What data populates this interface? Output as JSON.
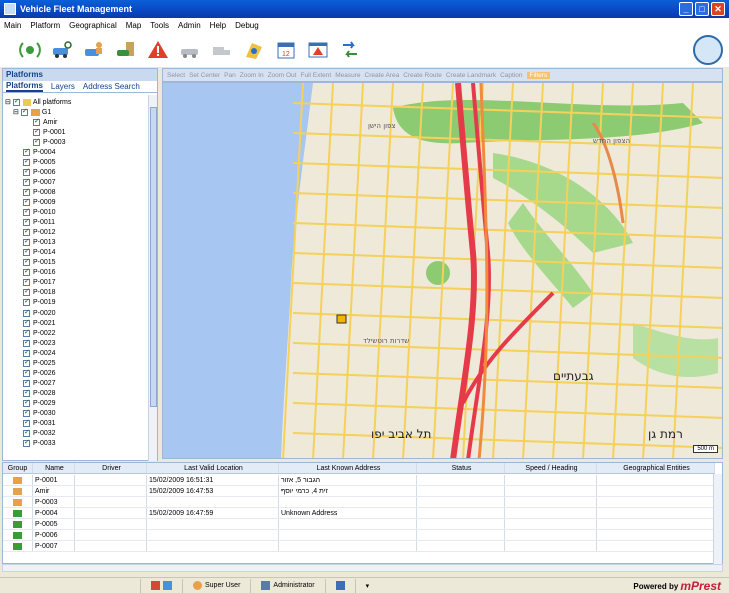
{
  "window": {
    "title": "Vehicle Fleet Management",
    "buttons": [
      "_",
      "□",
      "✕"
    ]
  },
  "menu": [
    "Main",
    "Platform",
    "Geographical",
    "Map",
    "Tools",
    "Admin",
    "Help",
    "Debug"
  ],
  "toolbar_icons": [
    "satellite-icon",
    "car-search-icon",
    "car-person-icon",
    "car-building-icon",
    "alert-icon",
    "car-gray-icon",
    "truck-gray-icon",
    "map-car-icon",
    "calendar-icon",
    "alert-window-icon",
    "network-icon"
  ],
  "colors": {
    "accent": "#0a47c2",
    "panel": "#c9d9ef",
    "road_major": "#e43a4a",
    "road_secondary": "#f4d15a",
    "park": "#8dcb72",
    "sea": "#a7c6f2",
    "brand": "#c41e3a"
  },
  "left_panel": {
    "header": "Platforms",
    "tabs": [
      "Platforms",
      "Layers",
      "Address Search"
    ],
    "tree": {
      "root": "All platforms",
      "group": "G1",
      "group_items": [
        "Amir",
        "P-0001",
        "P-0003"
      ],
      "items": [
        "P-0004",
        "P-0005",
        "P-0006",
        "P-0007",
        "P-0008",
        "P-0009",
        "P-0010",
        "P-0011",
        "P-0012",
        "P-0013",
        "P-0014",
        "P-0015",
        "P-0016",
        "P-0017",
        "P-0018",
        "P-0019",
        "P-0020",
        "P-0021",
        "P-0022",
        "P-0023",
        "P-0024",
        "P-0025",
        "P-0026",
        "P-0027",
        "P-0028",
        "P-0029",
        "P-0030",
        "P-0031",
        "P-0032",
        "P-0033"
      ]
    }
  },
  "map_toolbar": [
    "Select",
    "Set Center",
    "Pan",
    "Zoom In",
    "Zoom Out",
    "Full Extent",
    "Measure",
    "Create Area",
    "Create Route",
    "Create Landmark",
    "Caption",
    "Filters"
  ],
  "map": {
    "scale": "500 m",
    "labels": [
      "תל אביב יפו",
      "גבעתיים",
      "רמת גן",
      "צפון הישן",
      "הצפון החדש",
      "שדרות רוטשילד"
    ]
  },
  "grid": {
    "columns": [
      "Group",
      "Name",
      "Driver",
      "Last Valid Location",
      "Last Known Address",
      "Status",
      "Speed / Heading",
      "Geographical Entities"
    ],
    "rows": [
      {
        "icon": "car-person-icon",
        "name": "P-0001",
        "driver": "",
        "loc": "15/02/2009 16:51:31",
        "addr": "הגבור 5, אזור",
        "status": "",
        "speed": "",
        "geo": ""
      },
      {
        "icon": "car-person-icon",
        "name": "Amir",
        "driver": "",
        "loc": "15/02/2009 16:47:53",
        "addr": "זית 4, כרמי יוסף",
        "status": "",
        "speed": "",
        "geo": ""
      },
      {
        "icon": "car-person-icon",
        "name": "P-0003",
        "driver": "",
        "loc": "",
        "addr": "",
        "status": "",
        "speed": "",
        "geo": ""
      },
      {
        "icon": "car-green-icon",
        "name": "P-0004",
        "driver": "",
        "loc": "15/02/2009 16:47:59",
        "addr": "Unknown Address",
        "status": "",
        "speed": "",
        "geo": ""
      },
      {
        "icon": "car-green-icon",
        "name": "P-0005",
        "driver": "",
        "loc": "",
        "addr": "",
        "status": "",
        "speed": "",
        "geo": ""
      },
      {
        "icon": "car-green-icon",
        "name": "P-0006",
        "driver": "",
        "loc": "",
        "addr": "",
        "status": "",
        "speed": "",
        "geo": ""
      },
      {
        "icon": "car-green-icon",
        "name": "P-0007",
        "driver": "",
        "loc": "",
        "addr": "",
        "status": "",
        "speed": "",
        "geo": ""
      }
    ]
  },
  "statusbar": {
    "user": "Super User",
    "role": "Administrator",
    "powered_by": "Powered by",
    "brand": "mPrest"
  }
}
